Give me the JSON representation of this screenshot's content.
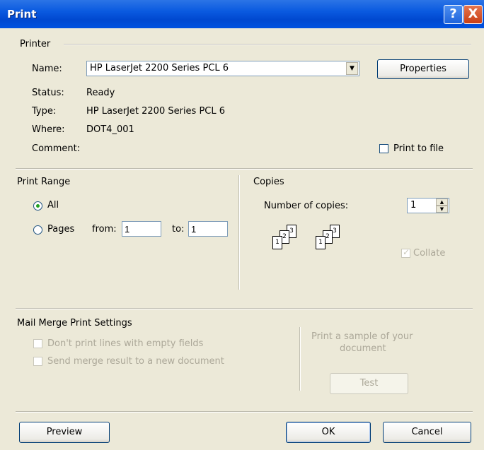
{
  "window": {
    "title": "Print",
    "help_glyph": "?",
    "close_glyph": "X"
  },
  "printer": {
    "group_label": "Printer",
    "name_label": "Name:",
    "name_value": "HP LaserJet 2200 Series PCL 6",
    "properties_label": "Properties",
    "status_label": "Status:",
    "status_value": "Ready",
    "type_label": "Type:",
    "type_value": "HP LaserJet 2200 Series PCL 6",
    "where_label": "Where:",
    "where_value": "DOT4_001",
    "comment_label": "Comment:",
    "print_to_file_label": "Print to file"
  },
  "print_range": {
    "group_label": "Print Range",
    "all_label": "All",
    "pages_label": "Pages",
    "from_label": "from:",
    "from_value": "1",
    "to_label": "to:",
    "to_value": "1",
    "selected": "All"
  },
  "copies": {
    "group_label": "Copies",
    "number_label": "Number of copies:",
    "number_value": "1",
    "collate_label": "Collate",
    "collate_checked": true,
    "collate_pages": [
      "1",
      "2",
      "3"
    ]
  },
  "mail_merge": {
    "group_label": "Mail Merge Print Settings",
    "no_empty_lines_label": "Don't print lines with empty fields",
    "send_new_doc_label": "Send merge result to a new document",
    "sample_text_line1": "Print a sample of your",
    "sample_text_line2": "document",
    "test_label": "Test"
  },
  "footer": {
    "preview_label": "Preview",
    "ok_label": "OK",
    "cancel_label": "Cancel"
  },
  "colors": {
    "titlebar": "#0A5AE0",
    "dialog_bg": "#ECE9D8",
    "disabled_text": "#ACA899",
    "close_button": "#C93E14"
  },
  "icons": [
    "help-icon",
    "close-icon",
    "dropdown-arrow-icon",
    "spin-up-icon",
    "spin-down-icon",
    "collate-pages-icon"
  ]
}
